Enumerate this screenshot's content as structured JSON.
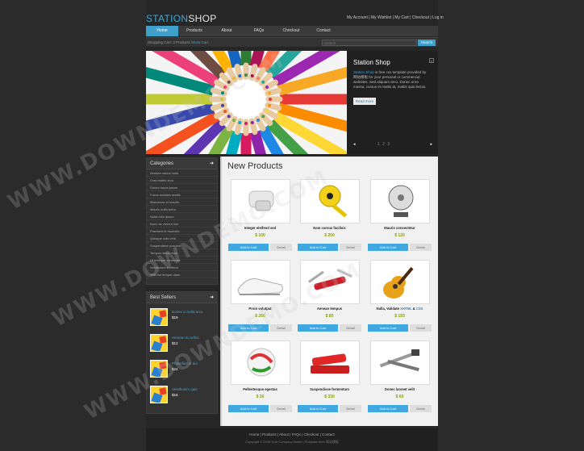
{
  "logo": {
    "part1": "STATION",
    "part2": "SHOP"
  },
  "top_links": "My Account | My Wishlist | My Cart | Checkout | Log in",
  "nav": [
    "Home",
    "Products",
    "About",
    "FAQs",
    "Checkout",
    "Contact"
  ],
  "cart": {
    "text": "Shopping Cart: 3 Products ",
    "link": "Show Cart"
  },
  "search": {
    "placeholder": "Search",
    "button": "Search"
  },
  "slider": {
    "title": "Station Shop",
    "desc_link": "Station Shop",
    "desc": " is free css template provided by 网站模板 for your personal or commercial websites. Sed aliquam arcu. Donec urna massa, cursus et mattis at, mattis quis lectus.",
    "read_more": "Read more",
    "prev": "◂",
    "next": "▸",
    "pages": "1 2 3"
  },
  "categories": {
    "title": "Categories",
    "items": [
      "Aenean varius nulla",
      "Cras mattis arcu",
      "Donec turpis ipsum",
      "Fusce sodales mattis",
      "Maecenas et mauris",
      "Mauris nulla tortor",
      "Nulla odio ipsum",
      "Nunc ac viverra nisi",
      "Praesent et molestie",
      "Quisque odio velit",
      "Suspendisse posuere",
      "Tempus lacus risus",
      "Ut tristique consectet",
      "Vestibulum eleifend",
      "Velit est tempor diam"
    ]
  },
  "best_sellers": {
    "title": "Best Sellers",
    "items": [
      {
        "name": "Donec in nulla arcu",
        "price": "$19"
      },
      {
        "name": "Aenean eu tellus",
        "price": "$12"
      },
      {
        "name": "Phasellus ut dui",
        "price": "$24"
      },
      {
        "name": "Vestibulum quis",
        "price": "$16"
      }
    ]
  },
  "products_title": "New Products",
  "products": [
    {
      "name": "Integer eleifend sed",
      "price": "$ 100",
      "img": "hair-clip"
    },
    {
      "name": "Nam cursus facilisis",
      "price": "$ 200",
      "img": "tape-measure"
    },
    {
      "name": "Mauris consectetur",
      "price": "$ 120",
      "img": "desk-fan"
    },
    {
      "name": "Proin volutpat",
      "price": "$ 260",
      "img": "sneakers"
    },
    {
      "name": "Aenean tempus",
      "price": "$ 80",
      "img": "pocket-knife"
    },
    {
      "name": "Nulla, Validate ",
      "name_link": "XHTML",
      "name_mid": " & ",
      "name_link2": "CSS",
      "price": "$ 193",
      "img": "guitar"
    },
    {
      "name": "Pellentesque egestas",
      "price": "$ 30",
      "img": "marble"
    },
    {
      "name": "Suspendisse fermentum",
      "price": "$ 330",
      "img": "stapler"
    },
    {
      "name": "Donec laoreet velit",
      "price": "$ 65",
      "img": "tools"
    }
  ],
  "add_to_cart": "Add to Cart",
  "detail": "Detail",
  "footer": {
    "links": "Home | Products | About | FAQs | Checkout | Contact",
    "copyright": "Copyright © 2048 Your Company Name | Template from 网站模板"
  },
  "watermark": "WWW.DOWNDEMO.COM",
  "colors": {
    "accent": "#3fa8d8",
    "price": "#8ea000",
    "button": "#3fa8e0"
  }
}
